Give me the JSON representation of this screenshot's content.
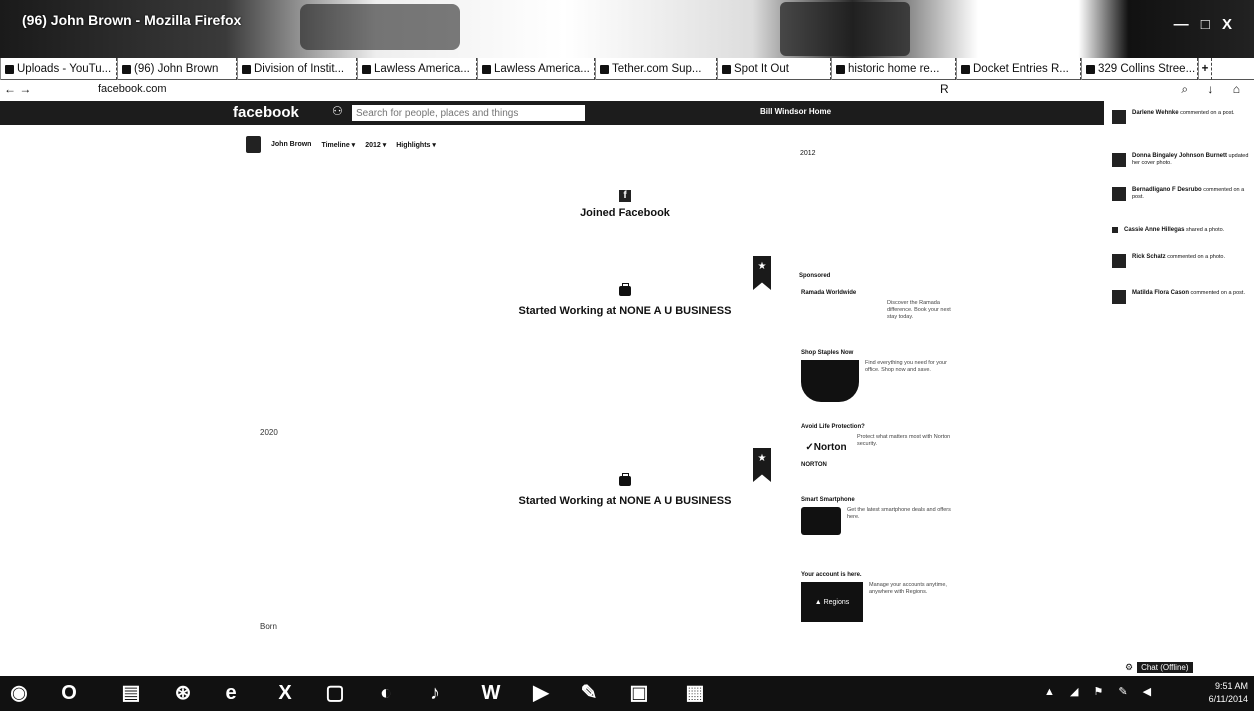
{
  "window": {
    "title": "(96) John Brown - Mozilla Firefox",
    "controls": "— □ X"
  },
  "tabs": [
    {
      "label": "Uploads - YouTu..."
    },
    {
      "label": "(96) John Brown"
    },
    {
      "label": "Division of Instit..."
    },
    {
      "label": "Lawless America..."
    },
    {
      "label": "Lawless America..."
    },
    {
      "label": "Tether.com Sup..."
    },
    {
      "label": "Spot It Out"
    },
    {
      "label": "historic home re..."
    },
    {
      "label": "Docket Entries R..."
    },
    {
      "label": "329 Collins Stree..."
    }
  ],
  "new_tab_label": "+",
  "urlbar": {
    "nav": "← →",
    "url": "facebook.com",
    "reader": "R",
    "tools": "⌕ ↓ ⌂"
  },
  "fb": {
    "logo": "facebook",
    "search_placeholder": "Search for people, places and things",
    "user_nav": "Bill Windsor   Home"
  },
  "subnav": {
    "name": "John Brown",
    "timeline": "Timeline ▾",
    "year": "2012 ▾",
    "highlights": "Highlights ▾"
  },
  "timeline": {
    "joined": "Joined Facebook",
    "work1": "Started Working at NONE A U BUSINESS",
    "work2": "Started Working at NONE A U BUSINESS",
    "year_label_1": "2020",
    "year_label_2": "Born"
  },
  "rightcol": {
    "top_label": "2012",
    "sponsored": "Sponsored"
  },
  "ads": [
    {
      "title": "Ramada Worldwide",
      "brand": "RAMADA",
      "text": "Discover the Ramada difference. Book your next stay today."
    },
    {
      "title": "Shop Staples Now",
      "brand": "",
      "text": "Find everything you need for your office. Shop now and save."
    },
    {
      "title": "Avoid Life Protection?",
      "brand": "✓Norton",
      "brand2": "NORTON",
      "text": "Protect what matters most with Norton security."
    },
    {
      "title": "Smart Smartphone",
      "brand": "",
      "text": "Get the latest smartphone deals and offers here."
    },
    {
      "title": "Your account is here.",
      "brand": "▲ Regions",
      "text": "Manage your accounts anytime, anywhere with Regions."
    }
  ],
  "ticker": [
    {
      "name": "Darlene Wehnke",
      "text": "commented on a post."
    },
    {
      "name": "Donna Bingaley Johnson Burnett",
      "text": "updated her cover photo."
    },
    {
      "name": "Bernadligano F Desrubo",
      "text": "commented on a post."
    },
    {
      "name": "Cassie Anne Hillegas",
      "text": "shared a photo."
    },
    {
      "name": "Rick Schatz",
      "text": "commented on a photo."
    },
    {
      "name": "Matilda Flora Cason",
      "text": "commented on a post."
    }
  ],
  "chat": {
    "label": "Chat (Offline)"
  },
  "taskbar": {
    "icons": [
      "start-orb",
      "outlook",
      "explorer",
      "chrome",
      "internet-explorer",
      "excel",
      "premiere",
      "firefox",
      "itunes",
      "word",
      "media-player",
      "paint",
      "photoshop",
      "calendar"
    ],
    "tray": "▲ ◢ ⚑ ✎ ◀",
    "time": "9:51 AM",
    "date": "6/11/2014"
  }
}
